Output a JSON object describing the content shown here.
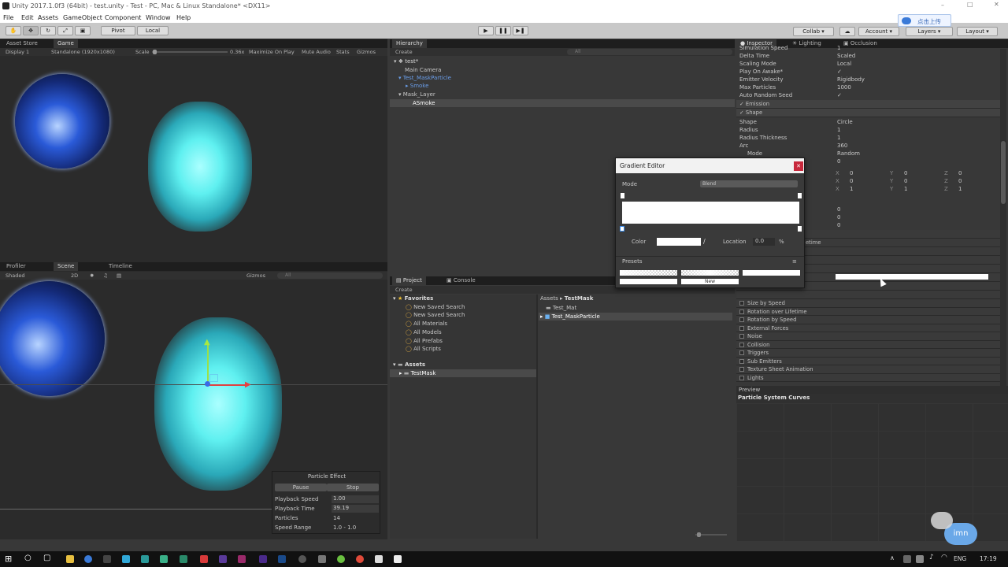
{
  "window": {
    "title": "Unity 2017.1.0f3 (64bit) - test.unity - Test - PC, Mac & Linux Standalone* <DX11>"
  },
  "menu": [
    "File",
    "Edit",
    "Assets",
    "GameObject",
    "Component",
    "Window",
    "Help"
  ],
  "toolbar": {
    "pivot": "Pivot",
    "local": "Local",
    "collab": "Collab ▾",
    "account": "Account",
    "layers": "Layers",
    "layout": "Layout",
    "upload_badge": "点击上传"
  },
  "game": {
    "tabs": [
      "Asset Store",
      "Game"
    ],
    "display": "Display 1",
    "resolution": "Standalone (1920x1080)",
    "scale_label": "Scale",
    "scale_value": "0.36x",
    "maximize": "Maximize On Play",
    "mute": "Mute Audio",
    "stats": "Stats",
    "gizmos": "Gizmos"
  },
  "scene": {
    "tabs": [
      "Profiler",
      "Scene",
      "Timeline"
    ],
    "shaded": "Shaded",
    "mode2d": "2D",
    "gizmos": "Gizmos",
    "search_placeholder": "All"
  },
  "particle_effect": {
    "title": "Particle Effect",
    "pause": "Pause",
    "stop": "Stop",
    "rows": [
      {
        "label": "Playback Speed",
        "value": "1.00"
      },
      {
        "label": "Playback Time",
        "value": "39.19"
      },
      {
        "label": "Particles",
        "value": "14"
      },
      {
        "label": "Speed Range",
        "value": "1.0 - 1.0"
      }
    ]
  },
  "hierarchy": {
    "tab": "Hierarchy",
    "create": "Create",
    "search_placeholder": "All",
    "items": [
      {
        "label": "test*",
        "indent": 0
      },
      {
        "label": "Main Camera",
        "indent": 1
      },
      {
        "label": "Test_MaskParticle",
        "indent": 1
      },
      {
        "label": "Smoke",
        "indent": 2
      },
      {
        "label": "Mask_Layer",
        "indent": 1
      },
      {
        "label": "ASmoke",
        "indent": 2
      }
    ]
  },
  "project": {
    "tabs": [
      "Project",
      "Console"
    ],
    "create": "Create",
    "favorites_header": "Favorites",
    "favorites": [
      "New Saved Search",
      "New Saved Search",
      "All Materials",
      "All Models",
      "All Prefabs",
      "All Scripts"
    ],
    "assets_header": "Assets",
    "assets_folders": [
      "TestMask"
    ],
    "breadcrumb_root": "Assets",
    "breadcrumb_sep": "▸",
    "breadcrumb_current": "TestMask",
    "files": [
      "Test_Mat",
      "Test_MaskParticle"
    ]
  },
  "inspector": {
    "tabs": [
      "Inspector",
      "Lighting",
      "Occlusion"
    ],
    "props": [
      {
        "label": "Simulation Speed",
        "value": "1"
      },
      {
        "label": "Delta Time",
        "value": "Scaled"
      },
      {
        "label": "Scaling Mode",
        "value": "Local"
      },
      {
        "label": "Play On Awake*",
        "value": "✓"
      },
      {
        "label": "Emitter Velocity",
        "value": "Rigidbody"
      },
      {
        "label": "Max Particles",
        "value": "1000"
      },
      {
        "label": "Auto Random Seed",
        "value": "✓"
      }
    ],
    "emission": "Emission",
    "shape": "Shape",
    "shape_props": [
      {
        "label": "Shape",
        "value": "Circle"
      },
      {
        "label": "Radius",
        "value": "1"
      },
      {
        "label": "Radius Thickness",
        "value": "1"
      },
      {
        "label": "Arc",
        "value": "360"
      },
      {
        "label": "Mode",
        "value": "Random"
      },
      {
        "label": "",
        "value": "0"
      }
    ],
    "vec_rows": [
      {
        "x": "0",
        "y": "0",
        "z": "0"
      },
      {
        "x": "0",
        "y": "0",
        "z": "0"
      },
      {
        "x": "1",
        "y": "1",
        "z": "1"
      }
    ],
    "misc_values": [
      "0",
      "0",
      "0"
    ],
    "lifetime_fragment": "etime",
    "modules": [
      "Size by Speed",
      "Rotation over Lifetime",
      "Rotation by Speed",
      "External Forces",
      "Noise",
      "Collision",
      "Triggers",
      "Sub Emitters",
      "Texture Sheet Animation",
      "Lights"
    ],
    "preview": "Preview",
    "curves_title": "Particle System Curves"
  },
  "gradient_editor": {
    "title": "Gradient Editor",
    "mode_label": "Mode",
    "mode_value": "Blend",
    "color_label": "Color",
    "location_label": "Location",
    "location_value": "0.0",
    "percent": "%",
    "presets_label": "Presets",
    "new_label": "New"
  },
  "taskbar": {
    "lang": "ENG",
    "time": "17:19"
  },
  "overlay": {
    "watermark": "imn"
  },
  "colors": {
    "unity_dark": "#383838",
    "hierarchy_blue": "#6a9eea",
    "particle_cyan": "#5ff0f0",
    "orb_blue": "#2a5ad8",
    "close_red": "#c8283c"
  }
}
